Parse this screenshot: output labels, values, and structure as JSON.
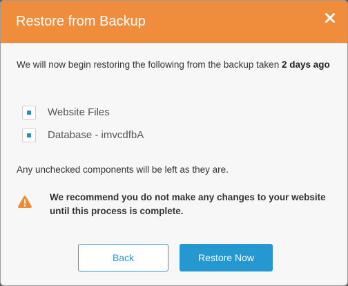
{
  "dialog": {
    "title": "Restore from Backup",
    "close_icon": "close-icon"
  },
  "intro": {
    "text": "We will now begin restoring the following from the backup taken ",
    "age": "2 days ago"
  },
  "components": [
    {
      "label": "Website Files",
      "checked": true
    },
    {
      "label": "Database - imvcdfbA",
      "checked": true
    }
  ],
  "note": "Any unchecked components will be left as they are.",
  "warning": {
    "icon": "warning-icon",
    "text": "We recommend you do not make any changes to your website until this process is complete."
  },
  "buttons": {
    "back": "Back",
    "restore": "Restore Now"
  },
  "colors": {
    "header": "#f08d3c",
    "primary": "#2597d1",
    "warning": "#ee8a3a",
    "checkbox_mark": "#2b8cc4"
  }
}
